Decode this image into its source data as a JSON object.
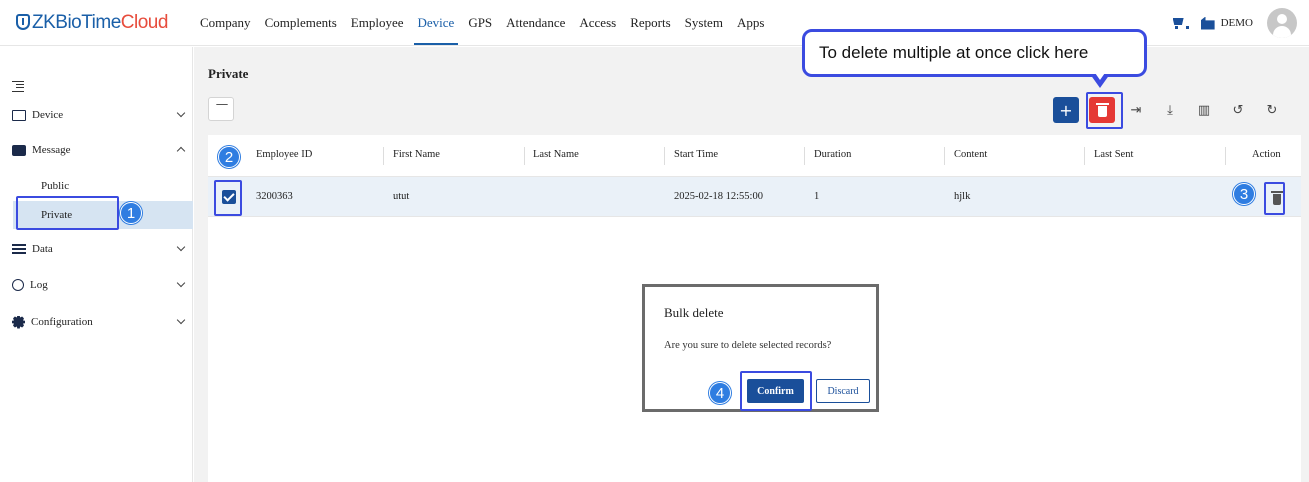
{
  "logo": {
    "part1": "ZKBioTime",
    "part2": "Cloud"
  },
  "nav": [
    "Company",
    "Complements",
    "Employee",
    "Device",
    "GPS",
    "Attendance",
    "Access",
    "Reports",
    "System",
    "Apps"
  ],
  "user": {
    "name": "DEMO"
  },
  "sidebar": {
    "device": "Device",
    "message": "Message",
    "public": "Public",
    "private": "Private",
    "data": "Data",
    "log": "Log",
    "configuration": "Configuration"
  },
  "page": {
    "title": "Private"
  },
  "table": {
    "headers": [
      "Employee ID",
      "First Name",
      "Last Name",
      "Start Time",
      "Duration",
      "Content",
      "Last Sent",
      "Action"
    ],
    "rows": [
      {
        "employee_id": "3200363",
        "first_name": "utut",
        "last_name": "",
        "start_time": "2025-02-18 12:55:00",
        "duration": "1",
        "content": "hjlk",
        "last_sent": ""
      }
    ]
  },
  "dialog": {
    "title": "Bulk delete",
    "message": "Are you sure to delete selected records?",
    "confirm": "Confirm",
    "discard": "Discard"
  },
  "annotation": {
    "callout": "To delete multiple at once click here",
    "badges": [
      "1",
      "2",
      "3",
      "4"
    ],
    "color": "#3b4be0",
    "badge_color": "#2f7de1"
  },
  "colors": {
    "brand": "#1a5fa8",
    "brand_accent": "#e74c3c",
    "delete": "#e53935",
    "selected_row": "#eaf1f8"
  }
}
